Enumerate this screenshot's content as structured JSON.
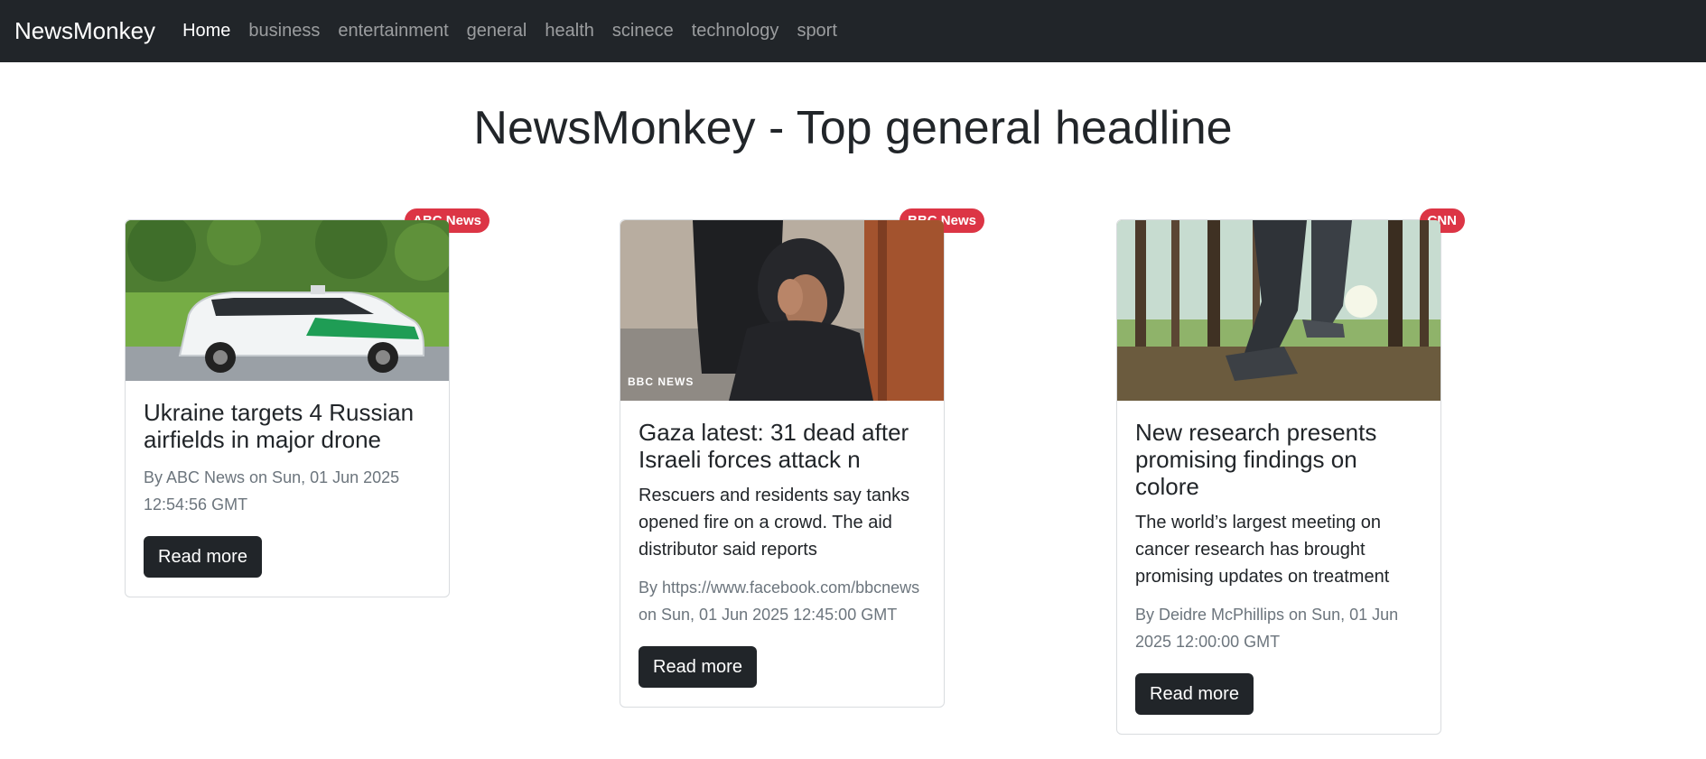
{
  "navbar": {
    "brand": "NewsMonkey",
    "links": [
      "Home",
      "business",
      "entertainment",
      "general",
      "health",
      "scinece",
      "technology",
      "sport"
    ]
  },
  "page": {
    "title": "NewsMonkey - Top general headline"
  },
  "cards": [
    {
      "source": "ABC News",
      "title": "Ukraine targets 4 Russian airfields in major drone",
      "description": "",
      "meta": "By ABC News on Sun, 01 Jun 2025 12:54:56 GMT",
      "button": "Read more"
    },
    {
      "source": "BBC News",
      "title": "Gaza latest: 31 dead after Israeli forces attack n",
      "description": "Rescuers and residents say tanks opened fire on a crowd. The aid distributor said reports",
      "meta": "By https://www.facebook.com/bbcnews on Sun, 01 Jun 2025 12:45:00 GMT",
      "button": "Read more",
      "image_watermark": "BBC NEWS"
    },
    {
      "source": "CNN",
      "title": "New research presents promising findings on colore",
      "description": "The world’s largest meeting on cancer research has brought promising updates on treatment",
      "meta": "By Deidre McPhillips on Sun, 01 Jun 2025 12:00:00 GMT",
      "button": "Read more"
    }
  ],
  "colors": {
    "navbar": "#212529",
    "badge": "#dc3545",
    "button": "#212529"
  }
}
